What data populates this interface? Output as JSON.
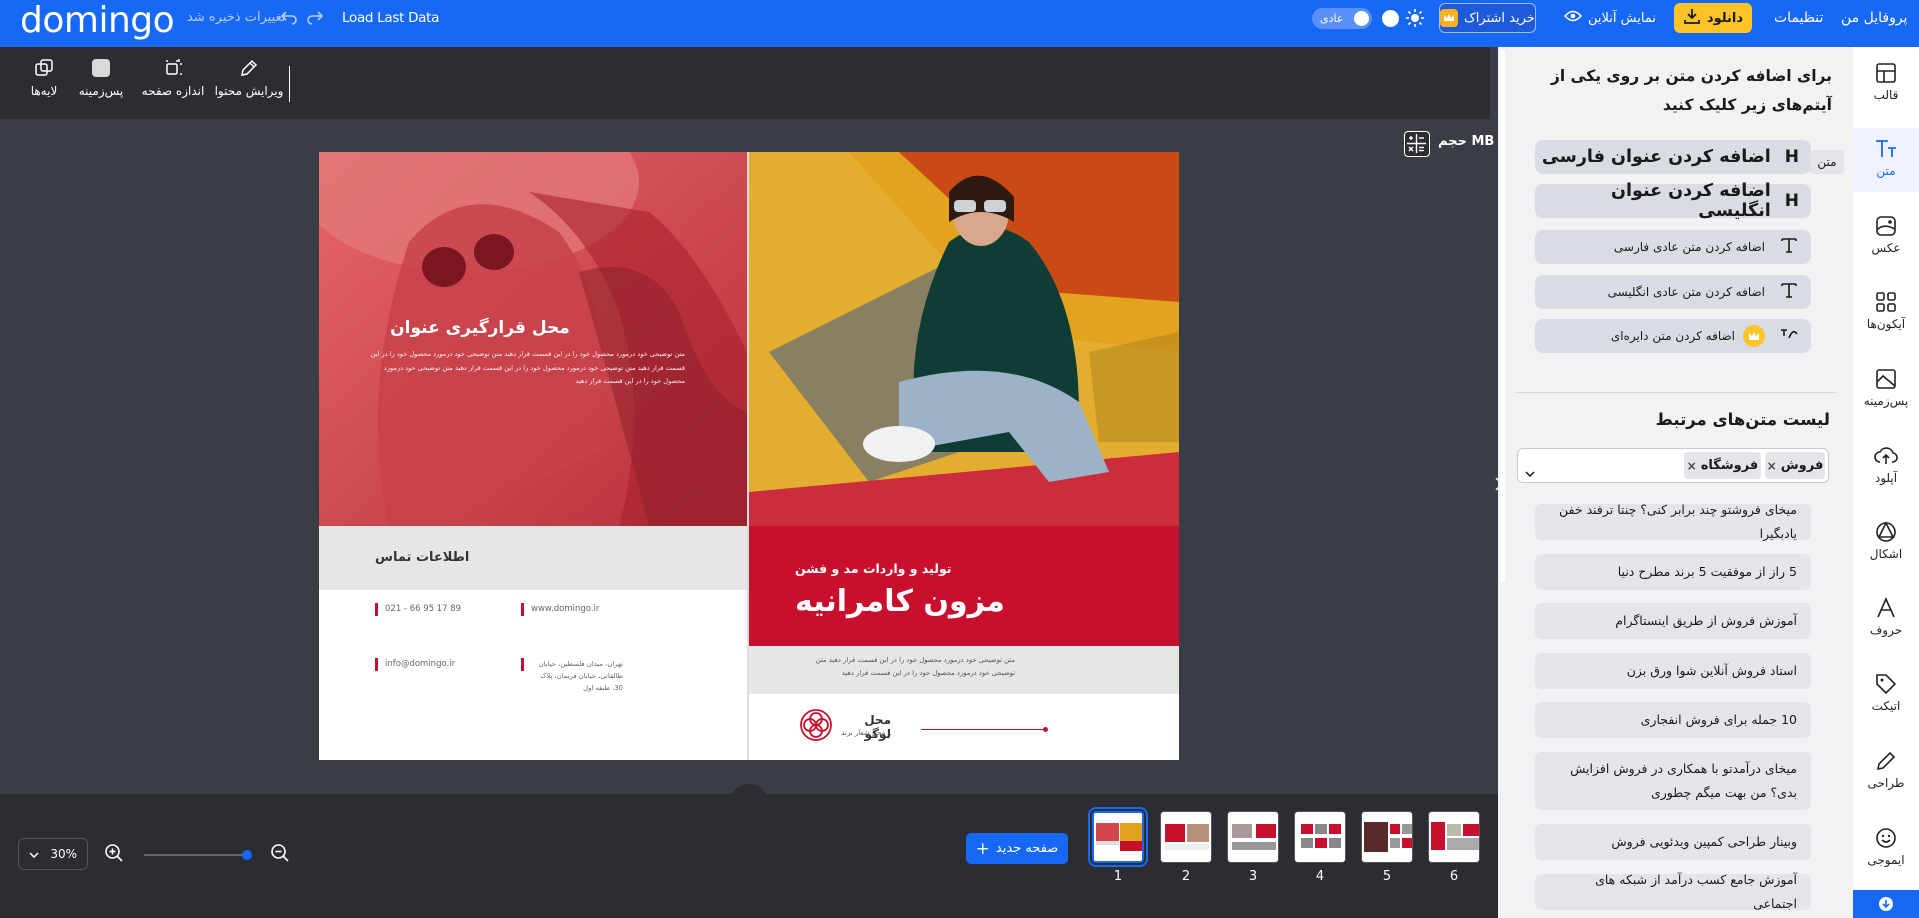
{
  "topbar": {
    "logo": "domingo",
    "unsaved_status": "تغییرات ذخیره شد",
    "load_last_data": "Load Last Data",
    "mode_label": "عادی",
    "buy_subscription": "خرید اشتراک",
    "online_preview": "نمایش آنلاین",
    "download": "دانلود",
    "settings": "تنظیمات",
    "my_profile": "پروفایل من",
    "colors": {
      "bar": "#1769f5",
      "download_btn": "#ffc32a"
    }
  },
  "toolbar": {
    "edit_content": "ویرایش محتوا",
    "page_size": "اندازه صفحه",
    "background": "پس‌زمینه",
    "layers": "لایه‌ها"
  },
  "canvas": {
    "size_label": "حجم MB",
    "left_page": {
      "headline": "محل قرارگیری عنوان",
      "body": "متن توضیحی خود درمورد محصول خود را در این قسمت قرار دهید متن توضیحی خود درمورد محصول خود را در این قسمت قرار دهید متن توضیحی خود درمورد محصول خود را در این قسمت قرار دهید متن توضیحی خود درمورد محصول خود را در این قسمت قرار دهید",
      "contact_title": "اطلاعات تماس",
      "phone": "021 - 66 95 17 89",
      "website": "www.domingo.ir",
      "email": "info@domingo.ir",
      "address": "تهران، میدان فلسطین، خیابان طالقانی، خیابان فریمان، پلاک 30، طبقه اول"
    },
    "right_page": {
      "subtitle": "تولید و واردات مد و فشن",
      "title": "مزون کامرانیه",
      "body": "متن توضیحی خود درمورد محصول خود را در این قسمت قرار دهید متن توضیحی خود درمورد محصول خود را در این قسمت قرار دهید",
      "logo_title": "محل لوگو",
      "logo_sub": "و محل شعار برند"
    },
    "colors": {
      "brand_red": "#c8102e",
      "photo_overlay": "#d9474f"
    }
  },
  "bottom": {
    "zoom": "30%",
    "new_page": "صفحه جدید",
    "pages": [
      "1",
      "2",
      "3",
      "4",
      "5",
      "6"
    ],
    "active_page": 1
  },
  "panel": {
    "instruction": "برای اضافه کردن متن بر روی یکی از آیتم‌های زیر کلیک کنید",
    "add_items": [
      {
        "label": "اضافه کردن عنوان فارسی",
        "icon": "heading-icon"
      },
      {
        "label": "اضافه کردن عنوان انگلیسی",
        "icon": "heading-icon"
      },
      {
        "label": "اضافه کردن متن عادی فارسی",
        "icon": "text-icon"
      },
      {
        "label": "اضافه کردن متن عادی انگلیسی",
        "icon": "text-icon"
      },
      {
        "label": "اضافه کردن متن دایره‌ای",
        "icon": "curve-text-icon"
      }
    ],
    "related_title": "لیست متن‌های مرتبط",
    "tags": [
      "فروش",
      "فروشگاه"
    ],
    "related": [
      "میخای فروشتو چند برابر کنی؟ چنتا ترفند خفن یادبگیرا",
      "5 راز از موفقیت 5 برند مطرح دنیا",
      "آموزش فروش از طریق اینستاگرام",
      "استاد فروش آنلاین شوا ورق بزن",
      "10 جمله برای فروش انفجاری",
      "میخای درآمدتو با همکاری در فروش افزایش بدی؟ من بهت میگم چطوری",
      "وبینار طراحی کمپین ویدئویی فروش",
      "آموزش جامع کسب درآمد از شبکه های اجتماعی"
    ],
    "tooltip": "متن"
  },
  "rail": [
    {
      "label": "قالب",
      "icon": "template-icon"
    },
    {
      "label": "متن",
      "icon": "text-tool-icon",
      "active": true
    },
    {
      "label": "عکس",
      "icon": "image-icon"
    },
    {
      "label": "آیکون‌ها",
      "icon": "icons-grid-icon"
    },
    {
      "label": "پس‌زمینه",
      "icon": "background-icon"
    },
    {
      "label": "آپلود",
      "icon": "upload-icon"
    },
    {
      "label": "اشکال",
      "icon": "shapes-icon"
    },
    {
      "label": "حروف",
      "icon": "font-icon"
    },
    {
      "label": "اتیکت",
      "icon": "sticker-icon"
    },
    {
      "label": "طراحی",
      "icon": "draw-icon"
    },
    {
      "label": "ایموجی",
      "icon": "emoji-icon"
    }
  ]
}
